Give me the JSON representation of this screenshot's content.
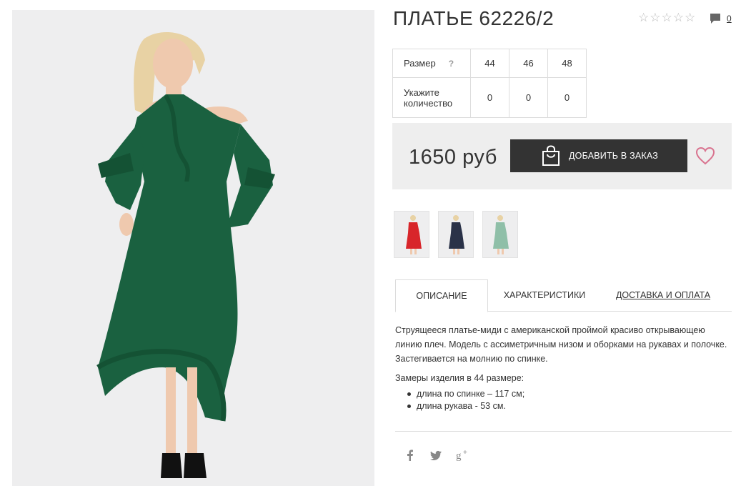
{
  "product": {
    "title": "ПЛАТЬЕ 62226/2",
    "rating": {
      "stars": 5,
      "filled": 0
    },
    "comments_count": "0",
    "price": "1650 руб",
    "add_to_cart_label": "ДОБАВИТЬ В ЗАКАЗ"
  },
  "size_table": {
    "size_label": "Размер",
    "help_label": "?",
    "sizes": [
      "44",
      "46",
      "48"
    ],
    "qty_label": "Укажите количество",
    "quantities": [
      "0",
      "0",
      "0"
    ]
  },
  "thumbnails": [
    {
      "color_name": "red",
      "color": "#d8252a"
    },
    {
      "color_name": "navy",
      "color": "#2a3248"
    },
    {
      "color_name": "mint",
      "color": "#8fbfa8"
    }
  ],
  "main_photo": {
    "dress_color": "#1a6140"
  },
  "tabs": [
    "ОПИСАНИЕ",
    "ХАРАКТЕРИСТИКИ",
    "ДОСТАВКА И ОПЛАТА"
  ],
  "description": {
    "text": "Струящееся платье-миди с американской проймой красиво открывающею линию плеч. Модель с ассиметричным низом и оборками на рукавах и полочке. Застегивается на молнию по спинке.",
    "measures_title": "Замеры изделия в 44 размере:",
    "measures": [
      "длина по спинке – 117 см;",
      "длина рукава - 53 см."
    ]
  },
  "social": [
    "facebook-icon",
    "twitter-icon",
    "google-plus-icon"
  ]
}
